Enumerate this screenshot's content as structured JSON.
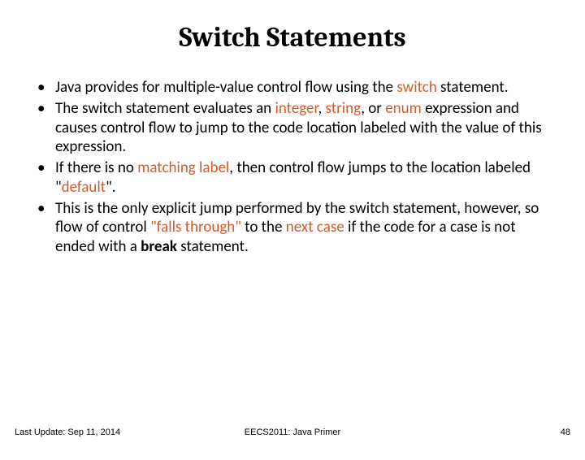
{
  "title": "Switch Statements",
  "bullets": {
    "b1a": "Java provides for multiple-value control flow using the ",
    "b1b": "switch",
    "b1c": " statement.",
    "b2a": "The switch statement evaluates an ",
    "b2b": "integer",
    "b2c": ", ",
    "b2d": "string",
    "b2e": ", or ",
    "b2f": "enum",
    "b2g": " expression and causes control flow to jump to the code location labeled with the value of this expression.",
    "b3a": "If there is no ",
    "b3b": "matching label",
    "b3c": ", then control flow jumps to the location labeled \"",
    "b3d": "default",
    "b3e": "\".",
    "b4a": "This is the only explicit jump performed by the switch statement, however, so flow of control ",
    "b4b": "\"falls through\"",
    "b4c": " to the ",
    "b4d": "next case",
    "b4e": " if the code for a case is not ended with a ",
    "b4f": "break",
    "b4g": " statement."
  },
  "footer": {
    "left": "Last Update: Sep 11, 2014",
    "center": "EECS2011: Java Primer",
    "right": "48"
  }
}
